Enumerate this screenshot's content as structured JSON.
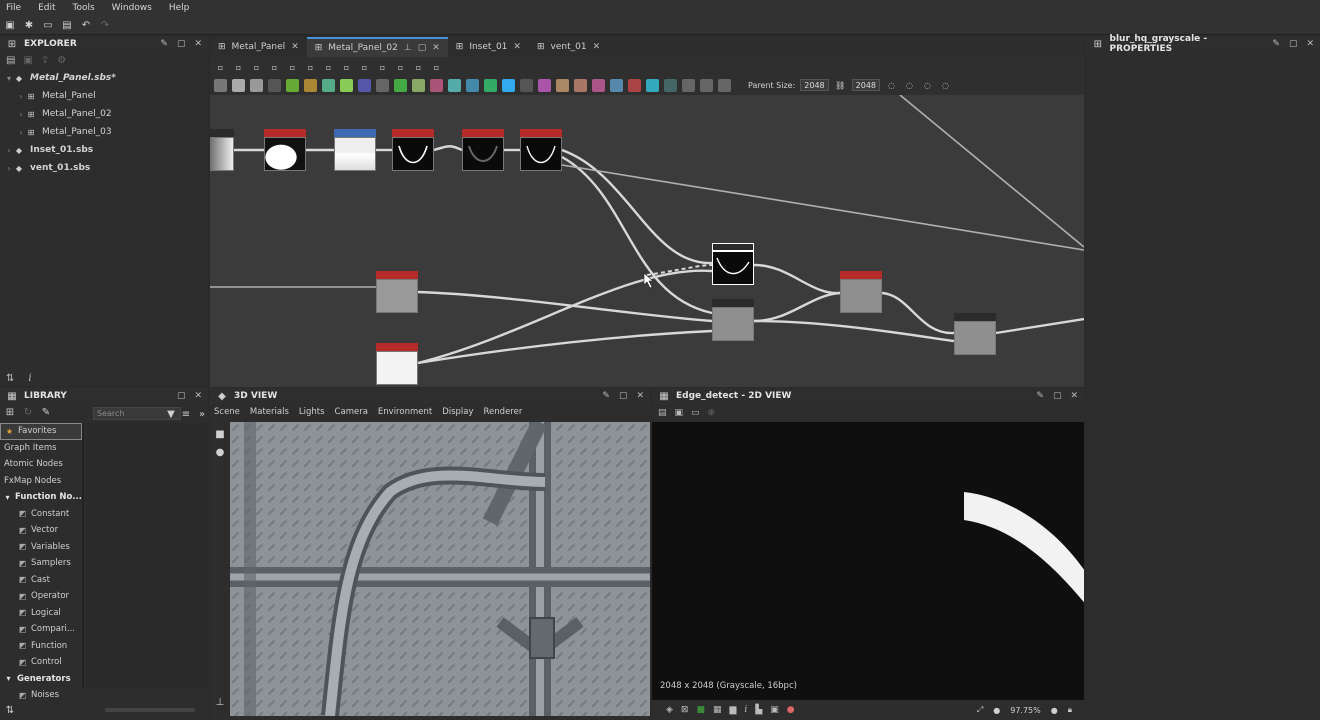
{
  "menu": [
    "File",
    "Edit",
    "Tools",
    "Windows",
    "Help"
  ],
  "explorer": {
    "title": "EXPLORER",
    "items": [
      {
        "label": "Metal_Panel.sbs*",
        "level": 0,
        "expanded": true,
        "italic": true
      },
      {
        "label": "Metal_Panel",
        "level": 1
      },
      {
        "label": "Metal_Panel_02",
        "level": 1
      },
      {
        "label": "Metal_Panel_03",
        "level": 1
      },
      {
        "label": "Inset_01.sbs",
        "level": 0
      },
      {
        "label": "vent_01.sbs",
        "level": 0
      }
    ]
  },
  "graph_tabs": [
    {
      "label": "Metal_Panel",
      "active": false
    },
    {
      "label": "Metal_Panel_02",
      "active": true
    },
    {
      "label": "Inset_01",
      "active": false
    },
    {
      "label": "vent_01",
      "active": false
    }
  ],
  "graph_toolbar": {
    "parent_size_label": "Parent Size:",
    "parent_size_value": "2048",
    "size_value": "2048"
  },
  "properties": {
    "title": "blur_hq_grayscale - PROPERTIES"
  },
  "library": {
    "title": "LIBRARY",
    "search_placeholder": "Search",
    "items": [
      {
        "label": "Favorites",
        "highlight": true,
        "icon": "star"
      },
      {
        "label": "Graph Items"
      },
      {
        "label": "Atomic Nodes"
      },
      {
        "label": "FxMap Nodes"
      },
      {
        "label": "Function No...",
        "bold": true
      },
      {
        "label": "Constant",
        "sub": true
      },
      {
        "label": "Vector",
        "sub": true
      },
      {
        "label": "Variables",
        "sub": true
      },
      {
        "label": "Samplers",
        "sub": true
      },
      {
        "label": "Cast",
        "sub": true
      },
      {
        "label": "Operator",
        "sub": true
      },
      {
        "label": "Logical",
        "sub": true
      },
      {
        "label": "Compari...",
        "sub": true
      },
      {
        "label": "Function",
        "sub": true
      },
      {
        "label": "Control",
        "sub": true
      },
      {
        "label": "Generators",
        "bold": true
      },
      {
        "label": "Noises",
        "sub": true
      }
    ]
  },
  "view3d": {
    "title": "3D VIEW",
    "menu": [
      "Scene",
      "Materials",
      "Lights",
      "Camera",
      "Environment",
      "Display",
      "Renderer"
    ]
  },
  "view2d": {
    "title": "Edge_detect - 2D VIEW",
    "info": "2048 x 2048 (Grayscale, 16bpc)",
    "zoom": "97.75%"
  }
}
